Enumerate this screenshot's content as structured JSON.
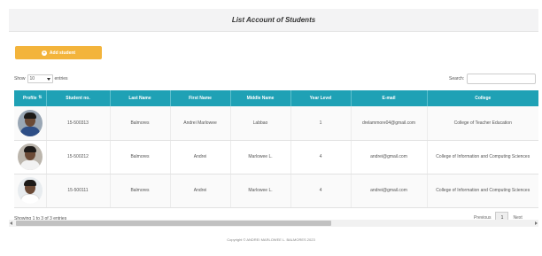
{
  "header": {
    "title": "List Account of Students"
  },
  "toolbar": {
    "add_label": "Add student"
  },
  "length": {
    "show_label": "Show",
    "selected": "10",
    "suffix": "entries"
  },
  "search": {
    "label": "Search:",
    "value": ""
  },
  "table": {
    "columns": [
      "Profile",
      "Student no.",
      "Last Name",
      "First Name",
      "Middle Name",
      "Year Level",
      "E-mail",
      "College"
    ],
    "rows": [
      {
        "avatar": "student-photo",
        "student_no": "15-500313",
        "last_name": "Balmores",
        "first_name": "Andrei Marlowee",
        "middle_name": "Labbao",
        "year_level": "1",
        "email": "drelammore04@gmail.com",
        "college": "College of Teacher Education"
      },
      {
        "avatar": "student-photo",
        "student_no": "15-500212",
        "last_name": "Balmores",
        "first_name": "Andrei",
        "middle_name": "Marlowee L.",
        "year_level": "4",
        "email": "andrei@gmail.com",
        "college": "College of Information and Computing Sciences"
      },
      {
        "avatar": "student-photo",
        "student_no": "15-500111",
        "last_name": "Balmores",
        "first_name": "Andrei",
        "middle_name": "Marlowee L.",
        "year_level": "4",
        "email": "andrei@gmail.com",
        "college": "College of Information and Computing Sciences"
      }
    ]
  },
  "pagination": {
    "info": "Showing 1 to 3 of 3 entries",
    "previous": "Previous",
    "current": "1",
    "next": "Next"
  },
  "footer": {
    "text": "Copyright © ANDREI MARLOWEE L. BALMORES 2023"
  },
  "colors": {
    "header_bg": "#1fa1b5",
    "add_button": "#f3b43b"
  },
  "icons": {
    "add": "plus-circle-icon",
    "sort": "sort-icon",
    "select": "caret-down-icon"
  }
}
